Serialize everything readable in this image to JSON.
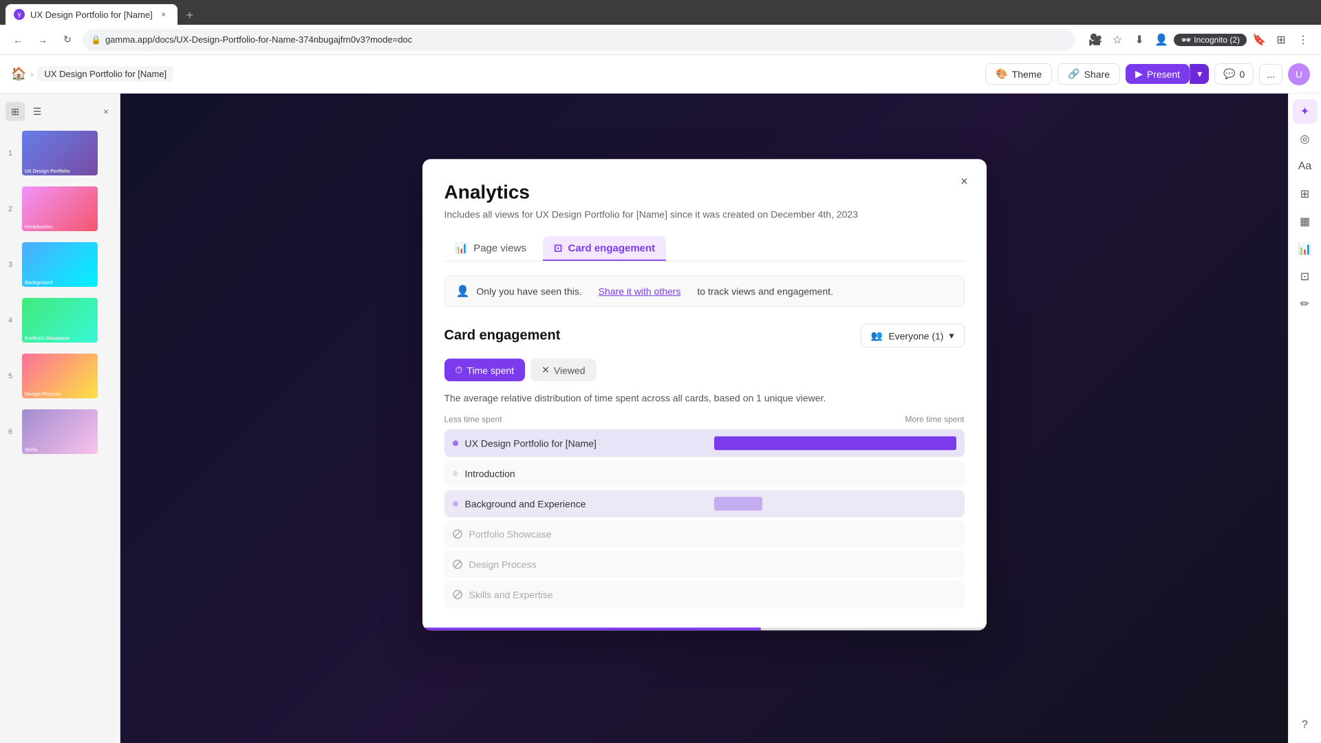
{
  "browser": {
    "tab_title": "UX Design Portfolio for [Name]",
    "url": "gamma.app/docs/UX-Design-Portfolio-for-Name-374nbugajfrn0v3?mode=doc",
    "new_tab_label": "+",
    "incognito_label": "Incognito (2)"
  },
  "toolbar": {
    "breadcrumb_home": "🏠",
    "breadcrumb_separator": ">",
    "breadcrumb_current": "UX Design Portfolio for [Name]",
    "theme_label": "Theme",
    "share_label": "Share",
    "present_label": "Present",
    "comments_label": "0",
    "more_label": "..."
  },
  "sidebar": {
    "slides": [
      {
        "number": "1",
        "label": "UX Design Portfolio for [Name]"
      },
      {
        "number": "2",
        "label": "Introduction"
      },
      {
        "number": "3",
        "label": "Background and Experience"
      },
      {
        "number": "4",
        "label": "Portfolio Showcase"
      },
      {
        "number": "5",
        "label": "Design Process"
      },
      {
        "number": "6",
        "label": "Skills and Expertise"
      }
    ]
  },
  "analytics_modal": {
    "title": "Analytics",
    "subtitle": "Includes all views for UX Design Portfolio for [Name] since it was created on December 4th, 2023",
    "close_label": "×",
    "tabs": [
      {
        "id": "page_views",
        "label": "Page views"
      },
      {
        "id": "card_engagement",
        "label": "Card engagement"
      }
    ],
    "active_tab": "card_engagement",
    "notice_text": "Only you have seen this.",
    "notice_link": "Share it with others",
    "notice_suffix": "to track views and engagement.",
    "section_title": "Card engagement",
    "everyone_label": "Everyone (1)",
    "subtabs": [
      {
        "id": "time_spent",
        "label": "Time spent"
      },
      {
        "id": "viewed",
        "label": "Viewed"
      }
    ],
    "active_subtab": "time_spent",
    "chart_desc": "The average relative distribution of time spent across all cards, based on 1 unique viewer.",
    "time_label_left": "Less time spent",
    "time_label_right": "More time spent",
    "cards": [
      {
        "name": "UX Design Portfolio for [Name]",
        "has_data": true,
        "bar_width": "100%",
        "dot_type": "full"
      },
      {
        "name": "Introduction",
        "has_data": false,
        "bar_width": "0%",
        "dot_type": "none"
      },
      {
        "name": "Background and Experience",
        "has_data": true,
        "bar_width": "15%",
        "dot_type": "light"
      },
      {
        "name": "Portfolio Showcase",
        "has_data": false,
        "bar_width": "0%",
        "dot_type": "hidden"
      },
      {
        "name": "Design Process",
        "has_data": false,
        "bar_width": "0%",
        "dot_type": "hidden"
      },
      {
        "name": "Skills and Expertise",
        "has_data": false,
        "bar_width": "0%",
        "dot_type": "hidden"
      }
    ]
  },
  "right_sidebar": {
    "icons": [
      "✦",
      "◎",
      "Aa",
      "⊞",
      "▦",
      "⚡",
      "⊡",
      "✏"
    ]
  }
}
